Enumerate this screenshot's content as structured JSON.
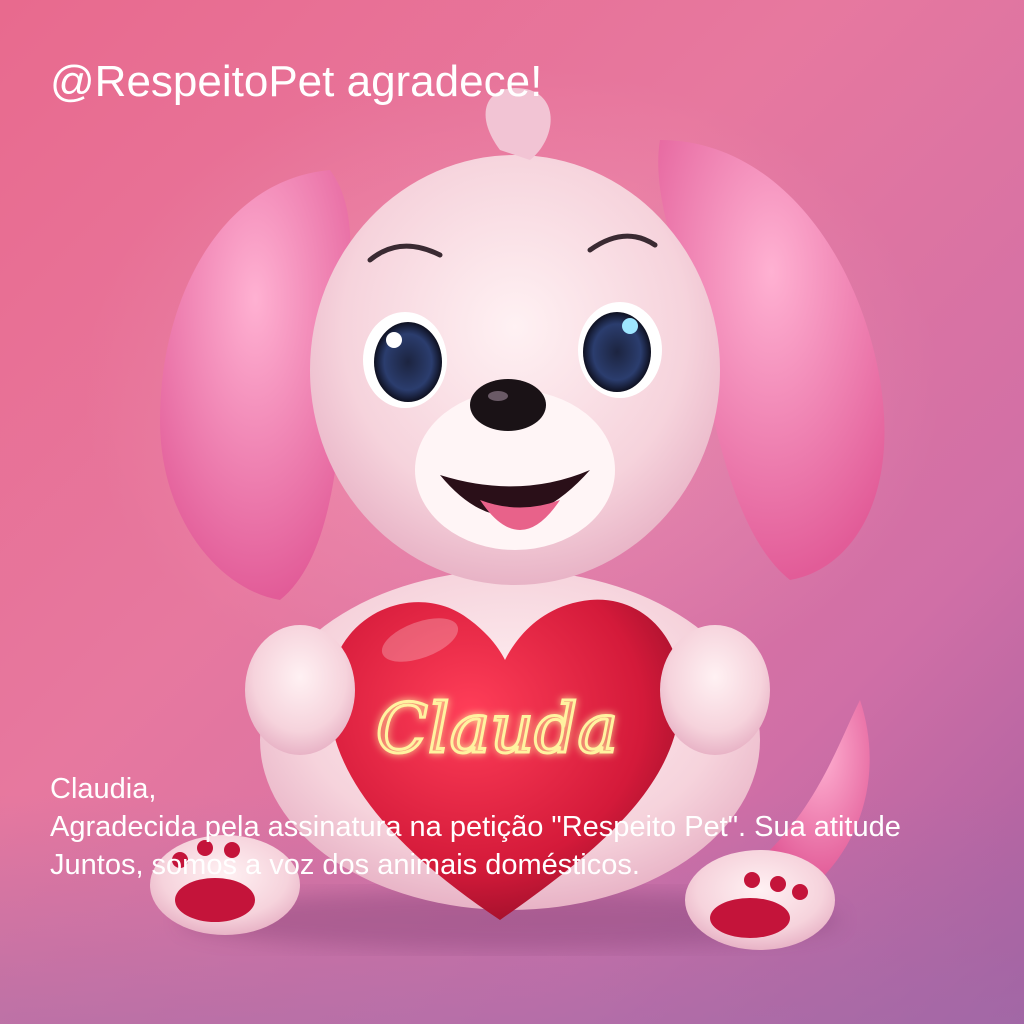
{
  "headline": "@RespeitoPet agradece!",
  "heart_name": "Clauda",
  "message": {
    "greeting": "Claudia,",
    "line1": "Agradecida pela assinatura na petição \"Respeito Pet\". Sua atitude",
    "line2": "Juntos, somos a voz dos animais domésticos."
  },
  "colors": {
    "background": "#e7789f",
    "heart": "#d41a3a",
    "glow_text": "#fff3a0",
    "text": "#ffffff"
  }
}
